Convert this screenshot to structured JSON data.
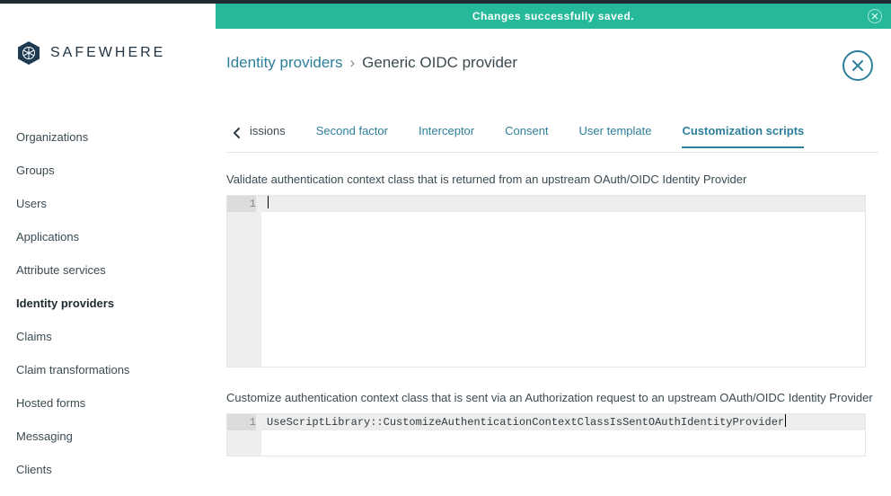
{
  "notification": {
    "text": "Changes successfully saved."
  },
  "brand": {
    "name": "SAFEWHERE"
  },
  "sidebar": {
    "items": [
      {
        "label": "Organizations",
        "active": false
      },
      {
        "label": "Groups",
        "active": false
      },
      {
        "label": "Users",
        "active": false
      },
      {
        "label": "Applications",
        "active": false
      },
      {
        "label": "Attribute services",
        "active": false
      },
      {
        "label": "Identity providers",
        "active": true
      },
      {
        "label": "Claims",
        "active": false
      },
      {
        "label": "Claim transformations",
        "active": false
      },
      {
        "label": "Hosted forms",
        "active": false
      },
      {
        "label": "Messaging",
        "active": false
      },
      {
        "label": "Clients",
        "active": false
      }
    ]
  },
  "breadcrumb": {
    "parent": "Identity providers",
    "sep": "›",
    "current": "Generic OIDC provider"
  },
  "tabs": {
    "partial": "issions",
    "items": [
      {
        "label": "Second factor",
        "active": false
      },
      {
        "label": "Interceptor",
        "active": false
      },
      {
        "label": "Consent",
        "active": false
      },
      {
        "label": "User template",
        "active": false
      },
      {
        "label": "Customization scripts",
        "active": true
      }
    ]
  },
  "section1": {
    "label": "Validate authentication context class that is returned from an upstream OAuth/OIDC Identity Provider",
    "lineNumber": "1",
    "code": ""
  },
  "section2": {
    "label": "Customize authentication context class that is sent via an Authorization request to an upstream OAuth/OIDC Identity Provider",
    "lineNumber": "1",
    "code": "UseScriptLibrary::CustomizeAuthenticationContextClassIsSentOAuthIdentityProvider"
  }
}
